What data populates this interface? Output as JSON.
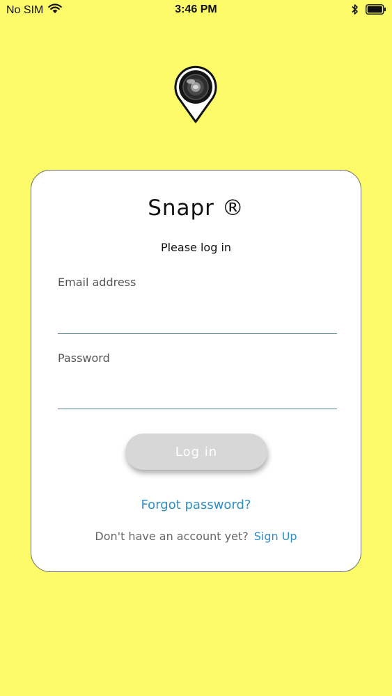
{
  "status_bar": {
    "carrier": "No SIM",
    "time": "3:46 PM"
  },
  "icons": {
    "wifi": "wifi-icon",
    "bluetooth": "bluetooth-icon",
    "battery": "battery-icon",
    "logo": "camera-location-pin-icon"
  },
  "login": {
    "title": "Snapr ®",
    "subtitle": "Please log in",
    "email_label": "Email address",
    "email_value": "",
    "password_label": "Password",
    "password_value": "",
    "login_button": "Log in",
    "forgot_password": "Forgot password?",
    "no_account_text": "Don't have an account yet?",
    "signup_link": "Sign Up"
  },
  "colors": {
    "background": "#fdfb6a",
    "card": "#ffffff",
    "link": "#2e8fc6",
    "button_disabled": "#d7d7d7"
  }
}
